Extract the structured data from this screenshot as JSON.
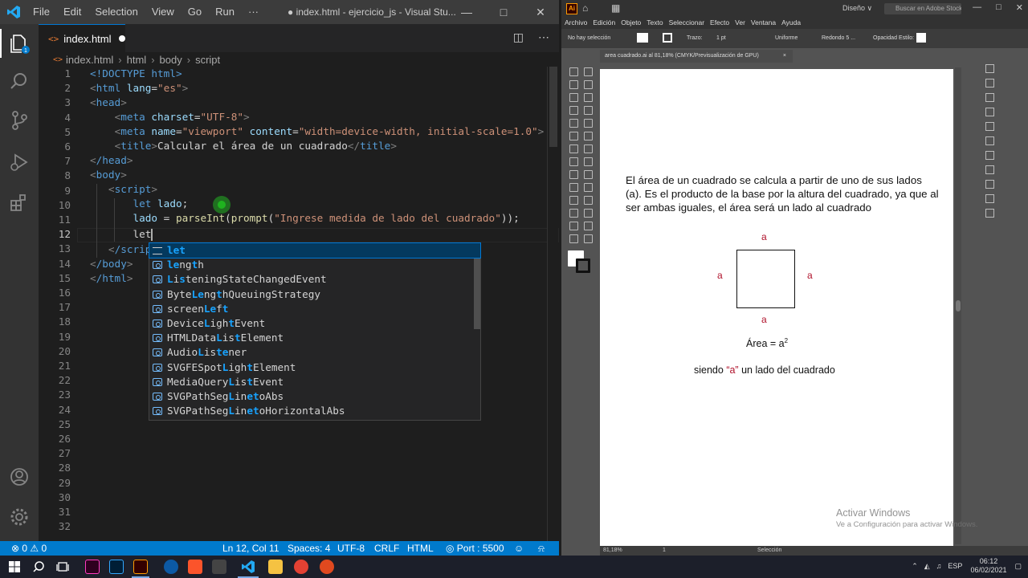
{
  "vscode": {
    "menu": [
      "File",
      "Edit",
      "Selection",
      "View",
      "Go",
      "Run",
      "···"
    ],
    "window_title": "● index.html - ejercicio_js - Visual Stu...",
    "tab_label": "index.html",
    "tab_icon_text": "<>",
    "breadcrumbs": [
      "index.html",
      "html",
      "body",
      "script"
    ],
    "line_numbers": [
      "1",
      "2",
      "3",
      "4",
      "5",
      "6",
      "7",
      "8",
      "9",
      "10",
      "11",
      "12",
      "13",
      "14",
      "15",
      "16",
      "17",
      "18",
      "19",
      "20",
      "21",
      "22",
      "23",
      "24",
      "25",
      "26",
      "27",
      "28",
      "29",
      "30",
      "31",
      "32"
    ],
    "current_line": "12",
    "code": {
      "l1": "<!DOCTYPE html>",
      "l2_tag": "html",
      "l2_attr": "lang",
      "l2_val": "\"es\"",
      "l3_tag": "head",
      "l4_tag": "meta",
      "l4_attr": "charset",
      "l4_val": "\"UTF-8\"",
      "l5_tag": "meta",
      "l5_attr1": "name",
      "l5_val1": "\"viewport\"",
      "l5_attr2": "content",
      "l5_val2": "\"width=device-width, initial-scale=1.0\"",
      "l6_tag": "title",
      "l6_text": "Calcular el área de un cuadrado",
      "l7_tag": "/head",
      "l8_tag": "body",
      "l9_tag": "script",
      "l10_kw": "let",
      "l10_var": "lado",
      "l10_rest": ";",
      "l11_var": "lado",
      "l11_eq": " = ",
      "l11_fn1": "parseInt",
      "l11_p1": "(",
      "l11_fn2": "prompt",
      "l11_p2": "(",
      "l11_str": "\"Ingrese medida de lado del cuadrado\"",
      "l11_end": "));",
      "l12_kw": "let",
      "l13_tag": "/scrip",
      "l14_tag": "/body",
      "l15_tag": "/html"
    },
    "suggestions": [
      {
        "pre": "",
        "hl": "let",
        "post": "",
        "kind": "keyword"
      },
      {
        "pre": "",
        "hl": "le",
        "mid": "ng",
        "hl2": "t",
        "post": "h",
        "kind": "prop"
      },
      {
        "pre": "",
        "hl": "L",
        "mid": "i",
        "hl2": "s",
        "post": "teningStateChangedEvent",
        "kind": "prop"
      },
      {
        "pre": "Byte",
        "hl": "Le",
        "mid": "ng",
        "hl2": "t",
        "post": "hQueuingStrategy",
        "kind": "prop"
      },
      {
        "pre": "screen",
        "hl": "Le",
        "mid": "f",
        "hl2": "t",
        "post": "",
        "kind": "prop"
      },
      {
        "pre": "Device",
        "hl": "L",
        "mid": "igh",
        "hl2": "t",
        "post": "Event",
        "kind": "prop"
      },
      {
        "pre": "HTMLData",
        "hl": "L",
        "mid": "is",
        "hl2": "t",
        "post": "Element",
        "kind": "prop"
      },
      {
        "pre": "Audio",
        "hl": "L",
        "mid": "is",
        "hl2": "te",
        "post": "ner",
        "kind": "prop"
      },
      {
        "pre": "SVGFESpot",
        "hl": "L",
        "mid": "igh",
        "hl2": "t",
        "post": "Element",
        "kind": "prop"
      },
      {
        "pre": "MediaQuery",
        "hl": "L",
        "mid": "is",
        "hl2": "t",
        "post": "Event",
        "kind": "prop"
      },
      {
        "pre": "SVGPathSeg",
        "hl": "L",
        "mid": "in",
        "hl2": "et",
        "post": "oAbs",
        "kind": "prop"
      },
      {
        "pre": "SVGPathSeg",
        "hl": "L",
        "mid": "in",
        "hl2": "et",
        "post": "oHorizontalAbs",
        "kind": "prop"
      }
    ],
    "status": {
      "errors": "⊗ 0 ⚠ 0",
      "position": "Ln 12, Col 11",
      "spaces": "Spaces: 4",
      "encoding": "UTF-8",
      "eol": "CRLF",
      "language": "HTML",
      "port": "◎ Port : 5500"
    }
  },
  "illustrator": {
    "logo": "Ai",
    "workspace": "Diseño ∨",
    "search_placeholder": "Buscar en Adobe Stock",
    "menu": [
      "Archivo",
      "Edición",
      "Objeto",
      "Texto",
      "Seleccionar",
      "Efecto",
      "Ver",
      "Ventana",
      "Ayuda"
    ],
    "control_bar": {
      "no_selection": "No hay selección",
      "stroke_label": "Trazo:",
      "stroke_value": "1 pt",
      "profile": "Uniforme",
      "brush": "Redondo 5 ...",
      "opacity": "Opacidad",
      "styles": "Estilo:"
    },
    "doc_tab": "area cuadrado.ai al 81,18% (CMYK/Previsualización de GPU)",
    "doc_tab_close": "×",
    "artboard": {
      "paragraph": "El área de un cuadrado se calcula a partir de uno de sus lados (a). Es el producto de la base por la altura del cuadrado, ya que al ser ambas iguales, el área será un lado al cuadrado",
      "side_label": "a",
      "formula_base": "Área = a",
      "formula_exp": "2",
      "siendo_pre": "siendo ",
      "siendo_a": "“a”",
      "siendo_post": " un lado del cuadrado"
    },
    "watermark_title": "Activar Windows",
    "watermark_sub": "Ve a Configuración para activar Windows.",
    "status": {
      "zoom": "81,18%",
      "page": "1",
      "tool": "Selección"
    }
  },
  "taskbar": {
    "lang": "ESP",
    "time": "06:12",
    "date": "06/02/2021",
    "colors": {
      "bg": "#1c1f2a",
      "vscode_accent": "#007acc",
      "illustrator_orange": "#ff9a00"
    }
  }
}
